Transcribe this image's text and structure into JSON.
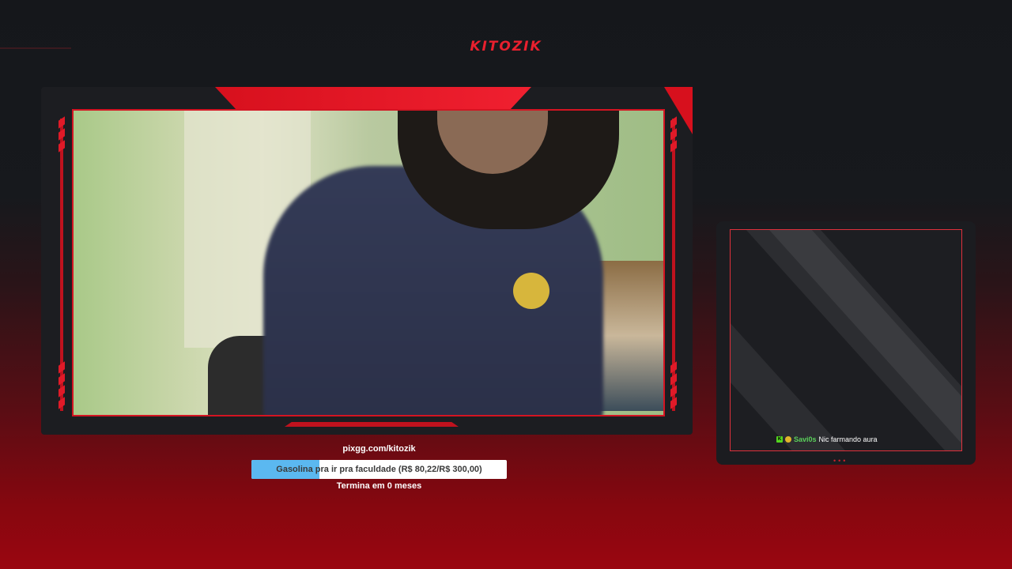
{
  "header": {
    "brand": "KITOZIK"
  },
  "webcam": {
    "label": "webcam feed"
  },
  "goal": {
    "url": "pixgg.com/kitozik",
    "text": "Gasolina pra ir pra faculdade (R$ 80,22/R$ 300,00)",
    "current": 80.22,
    "target": 300.0,
    "progress": 0.2674,
    "ends": "Termina em 0 meses",
    "fill_color": "#5bb8f0"
  },
  "chat": {
    "messages": [
      {
        "badges": [
          "k-badge-icon",
          "coin-badge-icon"
        ],
        "user": "Savi0s",
        "text": "Nic farmando aura"
      }
    ]
  },
  "colors": {
    "accent": "#e01a28",
    "background_top": "#15171b",
    "background_bottom": "#9a0610"
  }
}
